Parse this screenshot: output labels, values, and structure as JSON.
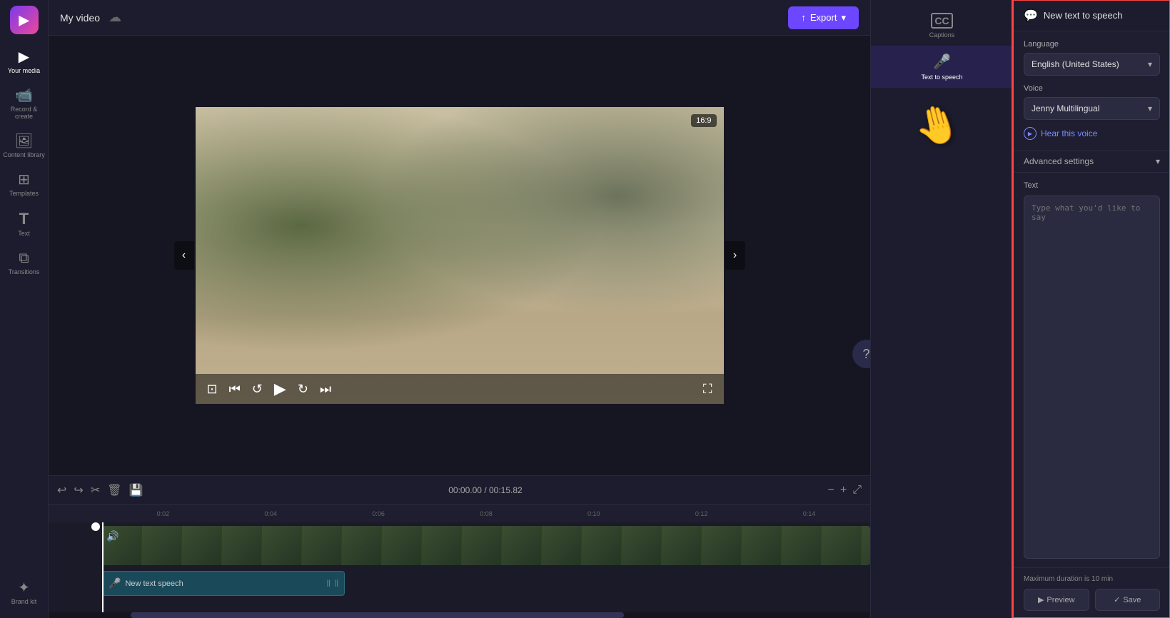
{
  "app": {
    "logo": "▶",
    "title": "My video",
    "cloud_icon": "☁",
    "export_label": "Export",
    "export_icon": "↑"
  },
  "sidebar": {
    "items": [
      {
        "id": "your-media",
        "icon": "▶",
        "label": "Your media"
      },
      {
        "id": "record",
        "icon": "🎥",
        "label": "Record & create"
      },
      {
        "id": "content",
        "icon": "🖼",
        "label": "Content library"
      },
      {
        "id": "templates",
        "icon": "⊞",
        "label": "Templates"
      },
      {
        "id": "text",
        "icon": "T",
        "label": "Text"
      },
      {
        "id": "transitions",
        "icon": "⧉",
        "label": "Transitions"
      },
      {
        "id": "brand",
        "icon": "✦",
        "label": "Brand kit"
      }
    ]
  },
  "video": {
    "aspect_ratio": "16:9",
    "nav_left": "‹",
    "nav_right": "›"
  },
  "controls": {
    "skip_back": "⏮",
    "rewind": "↺",
    "play": "▶",
    "forward": "↻",
    "skip_forward": "⏭",
    "fullscreen": "⛶",
    "scene": "⊡"
  },
  "timeline": {
    "undo": "↩",
    "redo": "↪",
    "cut": "✂",
    "delete": "🗑",
    "save": "💾",
    "current_time": "00:00.00",
    "total_time": "00:15.82",
    "zoom_in": "+",
    "zoom_out": "-",
    "expand": "⤢",
    "markers": [
      "0:02",
      "0:04",
      "0:06",
      "0:08",
      "0:10",
      "0:12",
      "0:14"
    ],
    "tts_track_label": "New text speech",
    "tts_track_icon": "🎤"
  },
  "right_sidebar": {
    "items": [
      {
        "id": "captions",
        "icon": "CC",
        "label": "Captions"
      },
      {
        "id": "tts",
        "icon": "🎤",
        "label": "Text to speech"
      }
    ]
  },
  "tts_panel": {
    "header_icon": "💬",
    "title": "New text to speech",
    "language_label": "Language",
    "language_value": "English (United States)",
    "voice_label": "Voice",
    "voice_value": "Jenny Multilingual",
    "hear_voice_label": "Hear this voice",
    "advanced_settings_label": "Advanced settings",
    "text_label": "Text",
    "text_placeholder": "Type what you'd like to say",
    "max_duration": "Maximum duration is 10 min",
    "preview_icon": "▶",
    "preview_label": "Preview",
    "save_icon": "✓",
    "save_label": "Save"
  }
}
